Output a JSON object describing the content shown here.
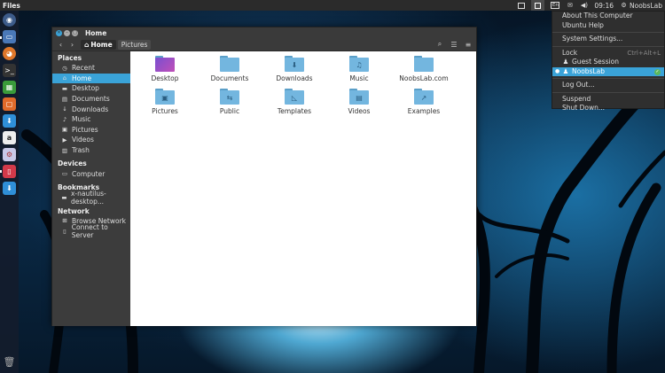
{
  "topbar": {
    "app_title": "Files",
    "clock": "09:16",
    "user": "NoobsLab",
    "icons": [
      "window-indicator-icon",
      "keyboard-en-icon",
      "mail-icon",
      "volume-icon",
      "gear-icon"
    ],
    "keyboard_label": "En"
  },
  "launcher": {
    "items": [
      "ubuntu-logo-icon",
      "files-icon",
      "firefox-icon",
      "terminal-icon",
      "spreadsheet-icon",
      "software-icon",
      "download-icon",
      "amazon-icon",
      "settings-icon",
      "app-icon",
      "download-icon-2",
      "trash-icon"
    ]
  },
  "window": {
    "title": "Home",
    "breadcrumbs": [
      "Home",
      "Pictures"
    ],
    "sidebar": {
      "sections": [
        {
          "title": "Places",
          "items": [
            {
              "label": "Recent",
              "icon": "clock-icon"
            },
            {
              "label": "Home",
              "icon": "home-icon"
            },
            {
              "label": "Desktop",
              "icon": "folder-icon"
            },
            {
              "label": "Documents",
              "icon": "document-icon"
            },
            {
              "label": "Downloads",
              "icon": "download-icon"
            },
            {
              "label": "Music",
              "icon": "music-icon"
            },
            {
              "label": "Pictures",
              "icon": "camera-icon"
            },
            {
              "label": "Videos",
              "icon": "video-icon"
            },
            {
              "label": "Trash",
              "icon": "trash-icon"
            }
          ]
        },
        {
          "title": "Devices",
          "items": [
            {
              "label": "Computer",
              "icon": "computer-icon"
            }
          ]
        },
        {
          "title": "Bookmarks",
          "items": [
            {
              "label": "x-nautilus-desktop...",
              "icon": "folder-icon"
            }
          ]
        },
        {
          "title": "Network",
          "items": [
            {
              "label": "Browse Network",
              "icon": "network-icon"
            },
            {
              "label": "Connect to Server",
              "icon": "server-icon"
            }
          ]
        }
      ],
      "selected": "Home"
    },
    "files": [
      {
        "label": "Desktop",
        "glyph": ""
      },
      {
        "label": "Documents",
        "glyph": ""
      },
      {
        "label": "Downloads",
        "glyph": "⬇"
      },
      {
        "label": "Music",
        "glyph": "♫"
      },
      {
        "label": "NoobsLab.com",
        "glyph": ""
      },
      {
        "label": "Pictures",
        "glyph": "▣"
      },
      {
        "label": "Public",
        "glyph": "⇆"
      },
      {
        "label": "Templates",
        "glyph": "◺"
      },
      {
        "label": "Videos",
        "glyph": "▤"
      },
      {
        "label": "Examples",
        "glyph": "↗"
      }
    ]
  },
  "session_menu": {
    "items": [
      {
        "label": "About This Computer",
        "type": "item"
      },
      {
        "label": "Ubuntu Help",
        "type": "item"
      },
      {
        "type": "sep"
      },
      {
        "label": "System Settings...",
        "type": "item"
      },
      {
        "type": "sep"
      },
      {
        "label": "Lock",
        "type": "item",
        "accel": "Ctrl+Alt+L"
      },
      {
        "label": "Guest Session",
        "type": "user"
      },
      {
        "label": "NoobsLab",
        "type": "user",
        "selected": true
      },
      {
        "type": "sep"
      },
      {
        "label": "Log Out...",
        "type": "item"
      },
      {
        "type": "sep"
      },
      {
        "label": "Suspend",
        "type": "item"
      },
      {
        "label": "Shut Down...",
        "type": "item"
      }
    ]
  },
  "colors": {
    "accent": "#3aa3d8",
    "folder": "#73b6df",
    "panel": "#2b2b2b"
  }
}
